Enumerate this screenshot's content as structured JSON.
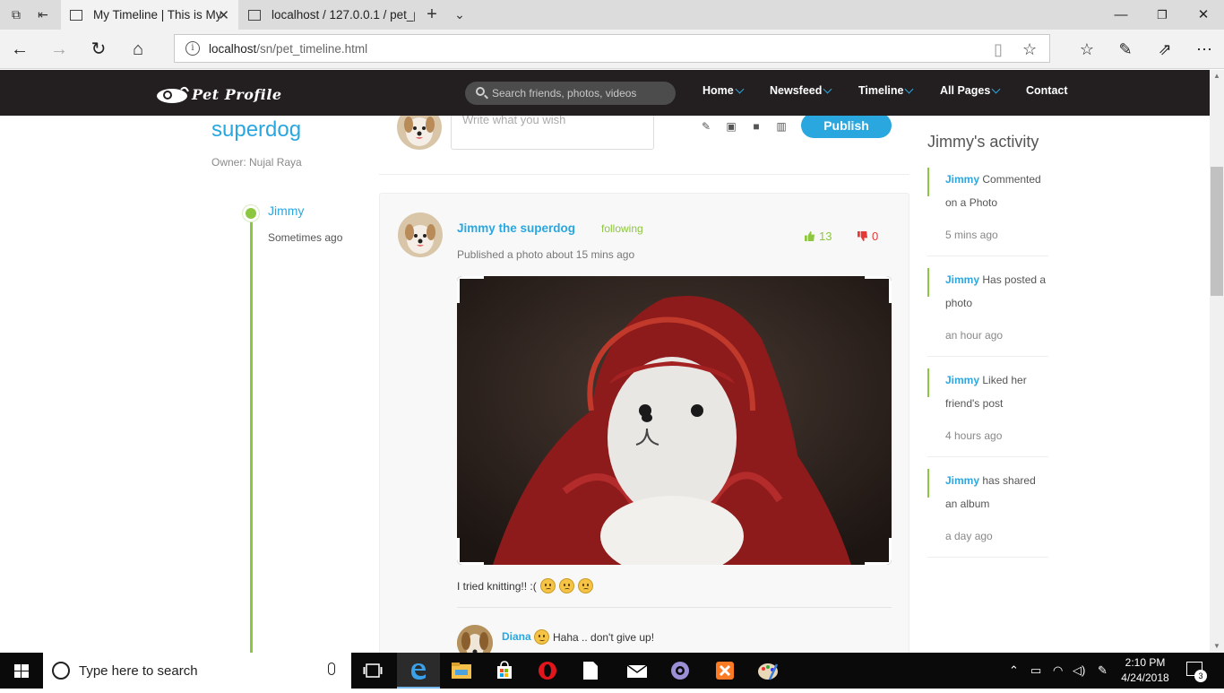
{
  "browser": {
    "tabs": [
      {
        "title": "My Timeline | This is My",
        "active": true
      },
      {
        "title": "localhost / 127.0.0.1 / pet_p",
        "active": false
      }
    ],
    "url_host": "localhost",
    "url_path": "/sn/pet_timeline.html",
    "icons": [
      "tab-preview-icon",
      "set-aside-tabs-icon",
      "new-tab-icon",
      "tab-list-icon",
      "back-icon",
      "forward-icon",
      "refresh-icon",
      "home-icon",
      "reading-view-icon",
      "favorite-star-icon",
      "favorites-hub-icon",
      "web-note-icon",
      "share-icon",
      "more-icon",
      "minimize-icon",
      "maximize-icon",
      "close-icon"
    ]
  },
  "site": {
    "logo_text": "Pet Profile",
    "search_placeholder": "Search friends, photos, videos",
    "nav": [
      {
        "label": "Home",
        "has_caret": true
      },
      {
        "label": "Newsfeed",
        "has_caret": true
      },
      {
        "label": "Timeline",
        "has_caret": true
      },
      {
        "label": "All Pages",
        "has_caret": true
      },
      {
        "label": "Contact",
        "has_caret": false
      }
    ],
    "colors": {
      "accent": "#2aa7df",
      "green": "#8dc63f",
      "dislike": "#e53935",
      "header_bg": "#231f20"
    }
  },
  "profile": {
    "name_line": "superdog",
    "owner": "Owner: Nujal Raya",
    "timeline_name": "Jimmy",
    "timeline_time": "Sometimes ago"
  },
  "composer": {
    "placeholder": "Write what you wish",
    "tools": [
      "edit-icon",
      "image-icon",
      "video-icon",
      "map-icon"
    ],
    "publish_label": "Publish"
  },
  "post": {
    "author": "Jimmy the superdog",
    "following": "following",
    "meta": "Published a photo about 15 mins ago",
    "likes": "13",
    "dislikes": "0",
    "caption": "I tried knitting!! :(",
    "comment": {
      "name": "Diana",
      "text": "Haha .. don't give up!"
    }
  },
  "activity": {
    "title": "Jimmy's activity",
    "items": [
      {
        "who": "Jimmy",
        "line1": " Commented",
        "line2": "on a Photo",
        "time": "5 mins ago"
      },
      {
        "who": "Jimmy",
        "line1": " Has posted a",
        "line2": "photo",
        "time": "an hour ago"
      },
      {
        "who": "Jimmy",
        "line1": " Liked her",
        "line2": "friend's post",
        "time": "4 hours ago"
      },
      {
        "who": "Jimmy",
        "line1": " has shared",
        "line2": "an album",
        "time": "a day ago"
      }
    ]
  },
  "taskbar": {
    "search_placeholder": "Type here to search",
    "time": "2:10 PM",
    "date": "4/24/2018",
    "notification_count": "3"
  }
}
